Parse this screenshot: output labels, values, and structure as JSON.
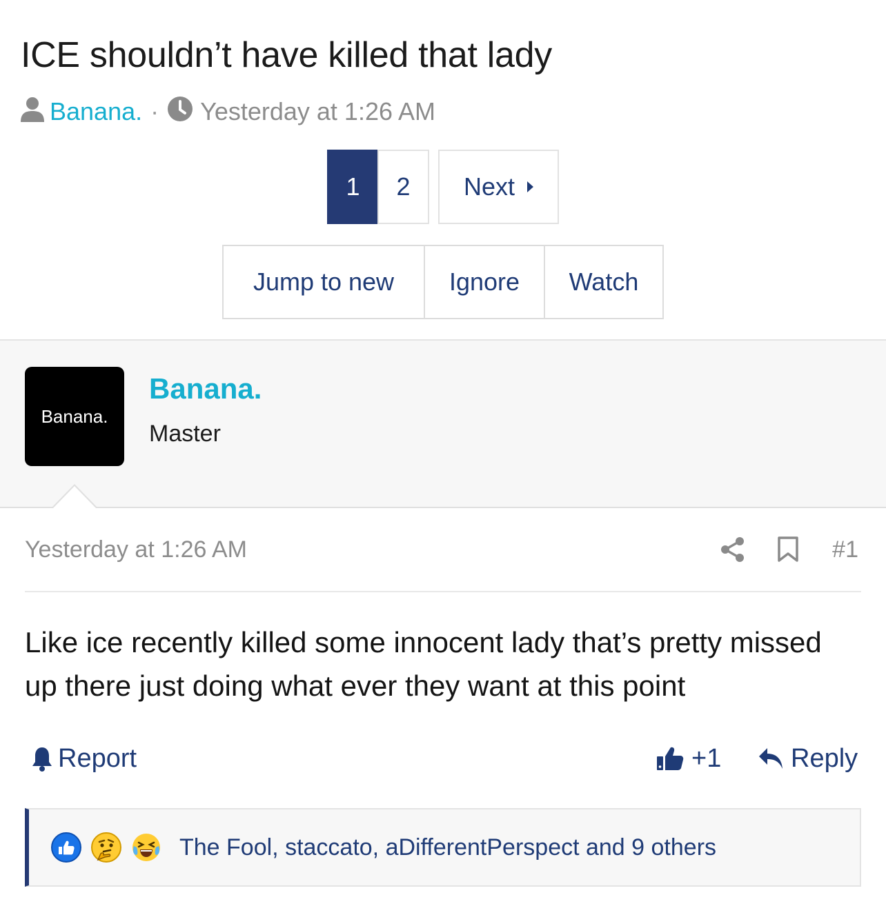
{
  "thread": {
    "title": "ICE shouldn’t have killed that lady",
    "author": "Banana.",
    "separator": "·",
    "started": "Yesterday at 1:26 AM"
  },
  "pagination": {
    "pages": [
      "1",
      "2"
    ],
    "current": "1",
    "next_label": "Next"
  },
  "thread_actions": {
    "jump_label": "Jump to new",
    "ignore_label": "Ignore",
    "watch_label": "Watch"
  },
  "post": {
    "avatar_text": "Banana.",
    "username": "Banana.",
    "user_title": "Master",
    "time": "Yesterday at 1:26 AM",
    "number": "#1",
    "body": "Like ice recently killed some innocent lady that’s pretty missed up there just doing what ever they want at this point",
    "report_label": "Report",
    "plus_label": "+1",
    "reply_label": "Reply",
    "reactions_text": "The Fool, staccato, aDifferentPerspect and 9 others",
    "reaction_icons": [
      "like-reaction-icon",
      "thinking-reaction-icon",
      "laughing-reaction-icon"
    ]
  },
  "colors": {
    "link": "#16aecf",
    "accent": "#253a74",
    "muted": "#8c8c8c"
  }
}
